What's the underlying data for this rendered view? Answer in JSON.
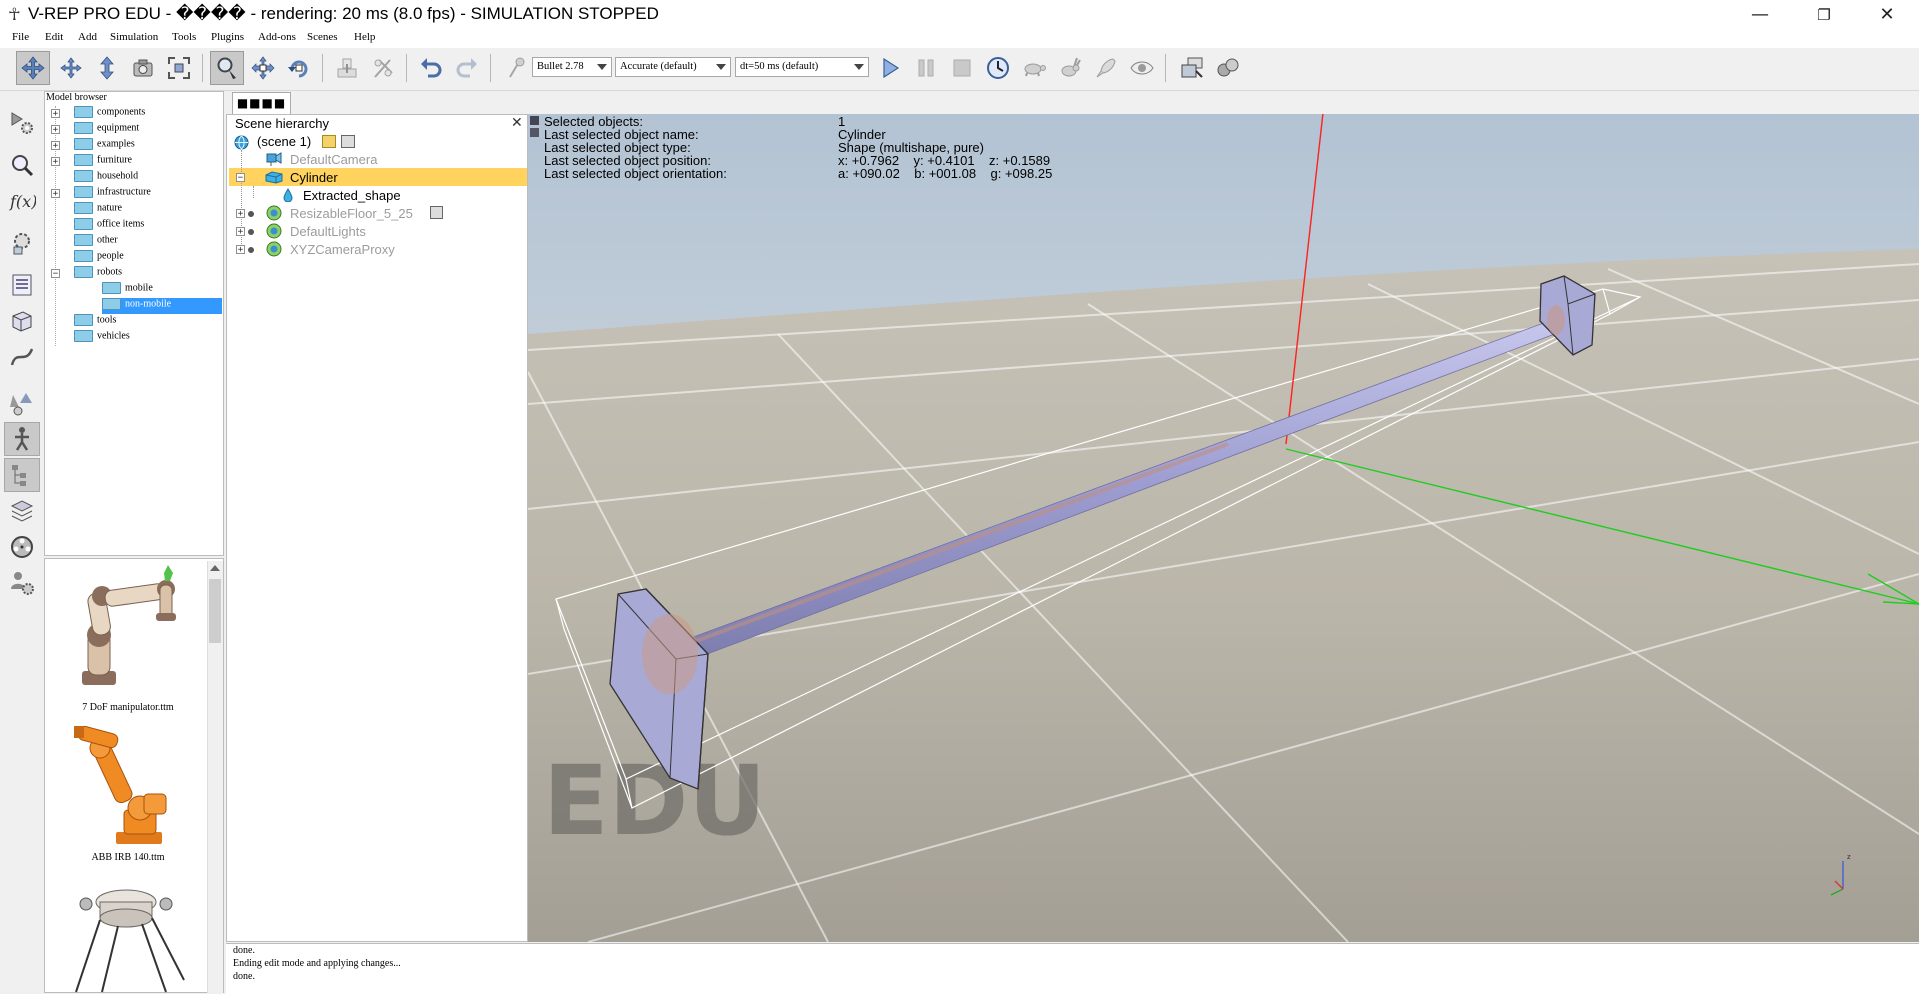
{
  "window": {
    "title": "V-REP PRO EDU - ���� - rendering: 20 ms (8.0 fps) - SIMULATION STOPPED",
    "minimize": "—",
    "maximize": "❐",
    "close": "✕"
  },
  "menu": [
    "File",
    "Edit",
    "Add",
    "Simulation",
    "Tools",
    "Plugins",
    "Add-ons",
    "Scenes",
    "Help"
  ],
  "toolbar": {
    "engine": "Bullet 2.78",
    "accuracy": "Accurate (default)",
    "timestep": "dt=50 ms (default)"
  },
  "model_browser": {
    "title": "Model browser",
    "items": [
      {
        "label": "components",
        "expandable": true
      },
      {
        "label": "equipment",
        "expandable": true
      },
      {
        "label": "examples",
        "expandable": true
      },
      {
        "label": "furniture",
        "expandable": true
      },
      {
        "label": "household",
        "expandable": false
      },
      {
        "label": "infrastructure",
        "expandable": true
      },
      {
        "label": "nature",
        "expandable": false
      },
      {
        "label": "office items",
        "expandable": false
      },
      {
        "label": "other",
        "expandable": false
      },
      {
        "label": "people",
        "expandable": false
      },
      {
        "label": "robots",
        "expandable": true,
        "expanded": true
      },
      {
        "label": "mobile",
        "child": true
      },
      {
        "label": "non-mobile",
        "child": true,
        "selected": true
      },
      {
        "label": "tools",
        "expandable": false
      },
      {
        "label": "vehicles",
        "expandable": false
      }
    ]
  },
  "thumbnails": [
    {
      "label": "7 DoF manipulator.ttm"
    },
    {
      "label": "ABB IRB 140.ttm"
    },
    {
      "label": ""
    }
  ],
  "scene_tab": "■■■■",
  "hierarchy": {
    "title": "Scene hierarchy",
    "close": "✕",
    "items": [
      {
        "label": "(scene 1)"
      },
      {
        "label": "DefaultCamera"
      },
      {
        "label": "Cylinder"
      },
      {
        "label": "Extracted_shape"
      },
      {
        "label": "ResizableFloor_5_25"
      },
      {
        "label": "DefaultLights"
      },
      {
        "label": "XYZCameraProxy"
      }
    ]
  },
  "info": {
    "labels": [
      "Selected objects:",
      "Last selected object name:",
      "Last selected object type:",
      "Last selected object position:",
      "Last selected object orientation:"
    ],
    "values": [
      "1",
      "Cylinder",
      "Shape (multishape, pure)",
      "x: +0.7962    y: +0.4101    z: +0.1589",
      "a: +090.02    b: +001.08    g: +098.25"
    ]
  },
  "watermark": "EDU",
  "status_lines": [
    "done.",
    "Ending edit mode and applying changes...",
    "done."
  ],
  "colors": {
    "selection_yellow": "#ffd35e",
    "selection_blue": "#3399ff",
    "x_axis": "#ff2020",
    "y_axis": "#20cc20"
  }
}
